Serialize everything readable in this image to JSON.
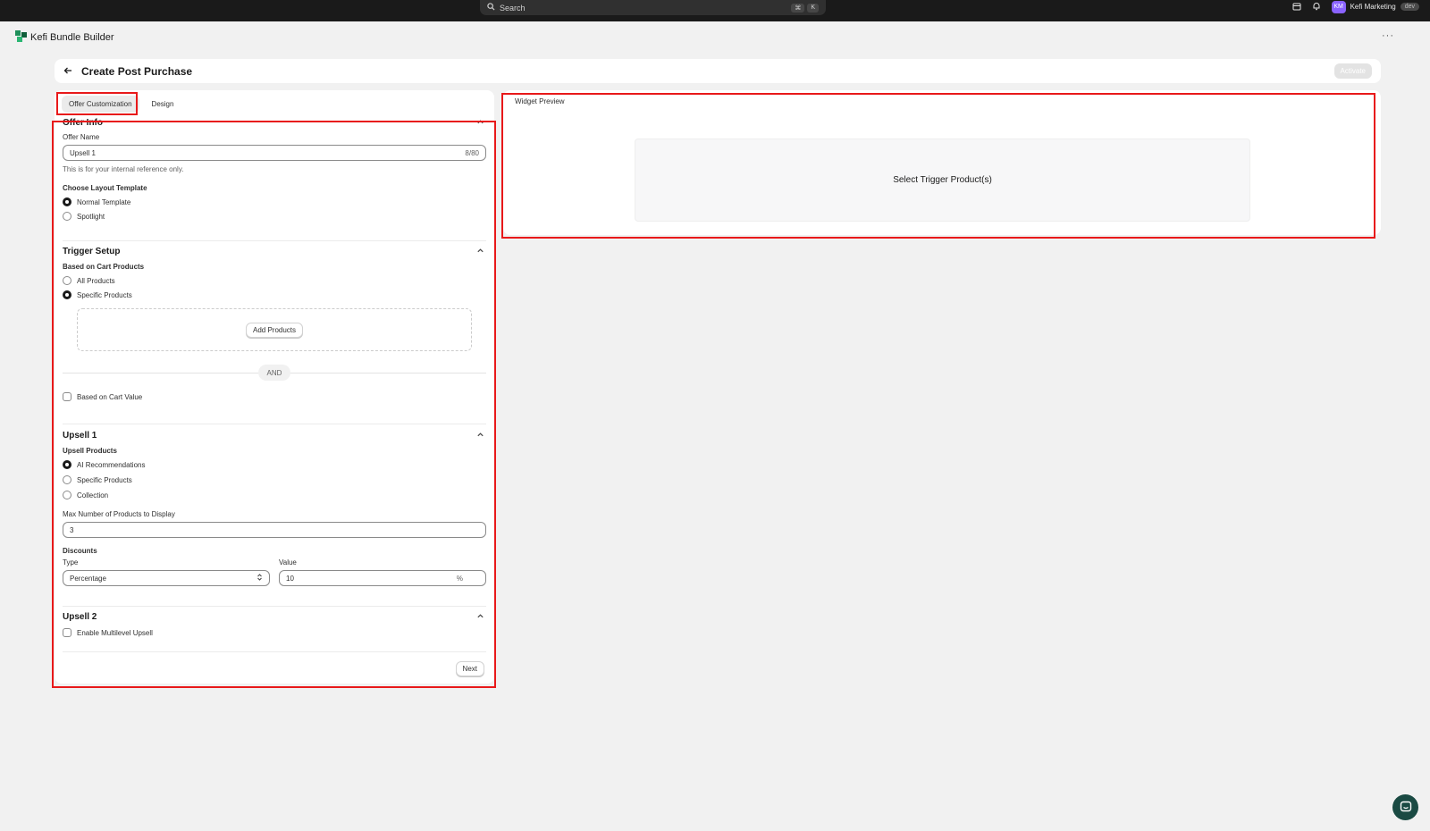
{
  "topbar": {
    "search_placeholder": "Search",
    "shortcut_keys": [
      "⌘",
      "K"
    ],
    "avatar_initials": "KM",
    "store_name": "Kefi Marketing",
    "store_badge": "dev"
  },
  "app": {
    "name": "Kefi Bundle Builder",
    "more_label": "···"
  },
  "header": {
    "title": "Create Post Purchase",
    "activate_label": "Activate"
  },
  "tabs": [
    {
      "label": "Offer Customization",
      "active": true
    },
    {
      "label": "Design",
      "active": false
    }
  ],
  "offer_info": {
    "title": "Offer Info",
    "offer_name_label": "Offer Name",
    "offer_name_value": "Upsell 1",
    "offer_name_counter": "8/80",
    "offer_name_hint": "This is for your internal reference only.",
    "layout_label": "Choose Layout Template",
    "layout_options": [
      {
        "label": "Normal Template",
        "selected": true
      },
      {
        "label": "Spotlight",
        "selected": false
      }
    ]
  },
  "trigger": {
    "title": "Trigger Setup",
    "cart_products_label": "Based on Cart Products",
    "options": [
      {
        "label": "All Products",
        "selected": false
      },
      {
        "label": "Specific Products",
        "selected": true
      }
    ],
    "add_products_label": "Add Products",
    "and_label": "AND",
    "cart_value_label": "Based on Cart Value",
    "cart_value_checked": false
  },
  "upsell1": {
    "title": "Upsell 1",
    "products_label": "Upsell Products",
    "options": [
      {
        "label": "AI Recommendations",
        "selected": true
      },
      {
        "label": "Specific Products",
        "selected": false
      },
      {
        "label": "Collection",
        "selected": false
      }
    ],
    "max_label": "Max Number of Products to Display",
    "max_value": "3",
    "discounts_label": "Discounts",
    "type_label": "Type",
    "type_value": "Percentage",
    "value_label": "Value",
    "value_value": "10",
    "value_suffix": "%"
  },
  "upsell2": {
    "title": "Upsell 2",
    "multilevel_label": "Enable Multilevel Upsell",
    "multilevel_checked": false
  },
  "footer": {
    "next_label": "Next"
  },
  "preview": {
    "label": "Widget Preview",
    "placeholder": "Select Trigger Product(s)"
  },
  "colors": {
    "highlight": "#e8191a",
    "topbar": "#1a1a1a",
    "avatar": "#8a63ff",
    "chat": "#1a4a43"
  },
  "icons": [
    "search-icon",
    "store-icon",
    "bell-icon",
    "app-logo-icon",
    "back-arrow-icon",
    "chevron-up-icon",
    "select-arrows-icon",
    "chat-icon"
  ]
}
